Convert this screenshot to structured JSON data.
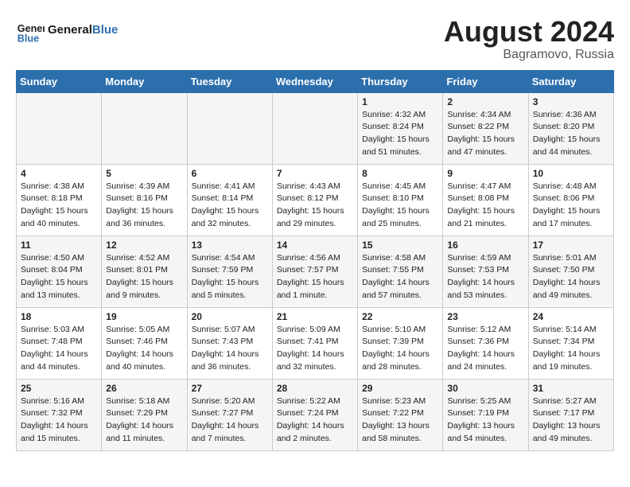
{
  "header": {
    "logo_text_part1": "General",
    "logo_text_part2": "Blue",
    "month_year": "August 2024",
    "location": "Bagramovo, Russia"
  },
  "weekdays": [
    "Sunday",
    "Monday",
    "Tuesday",
    "Wednesday",
    "Thursday",
    "Friday",
    "Saturday"
  ],
  "weeks": [
    [
      {
        "day": "",
        "info": ""
      },
      {
        "day": "",
        "info": ""
      },
      {
        "day": "",
        "info": ""
      },
      {
        "day": "",
        "info": ""
      },
      {
        "day": "1",
        "info": "Sunrise: 4:32 AM\nSunset: 8:24 PM\nDaylight: 15 hours\nand 51 minutes."
      },
      {
        "day": "2",
        "info": "Sunrise: 4:34 AM\nSunset: 8:22 PM\nDaylight: 15 hours\nand 47 minutes."
      },
      {
        "day": "3",
        "info": "Sunrise: 4:36 AM\nSunset: 8:20 PM\nDaylight: 15 hours\nand 44 minutes."
      }
    ],
    [
      {
        "day": "4",
        "info": "Sunrise: 4:38 AM\nSunset: 8:18 PM\nDaylight: 15 hours\nand 40 minutes."
      },
      {
        "day": "5",
        "info": "Sunrise: 4:39 AM\nSunset: 8:16 PM\nDaylight: 15 hours\nand 36 minutes."
      },
      {
        "day": "6",
        "info": "Sunrise: 4:41 AM\nSunset: 8:14 PM\nDaylight: 15 hours\nand 32 minutes."
      },
      {
        "day": "7",
        "info": "Sunrise: 4:43 AM\nSunset: 8:12 PM\nDaylight: 15 hours\nand 29 minutes."
      },
      {
        "day": "8",
        "info": "Sunrise: 4:45 AM\nSunset: 8:10 PM\nDaylight: 15 hours\nand 25 minutes."
      },
      {
        "day": "9",
        "info": "Sunrise: 4:47 AM\nSunset: 8:08 PM\nDaylight: 15 hours\nand 21 minutes."
      },
      {
        "day": "10",
        "info": "Sunrise: 4:48 AM\nSunset: 8:06 PM\nDaylight: 15 hours\nand 17 minutes."
      }
    ],
    [
      {
        "day": "11",
        "info": "Sunrise: 4:50 AM\nSunset: 8:04 PM\nDaylight: 15 hours\nand 13 minutes."
      },
      {
        "day": "12",
        "info": "Sunrise: 4:52 AM\nSunset: 8:01 PM\nDaylight: 15 hours\nand 9 minutes."
      },
      {
        "day": "13",
        "info": "Sunrise: 4:54 AM\nSunset: 7:59 PM\nDaylight: 15 hours\nand 5 minutes."
      },
      {
        "day": "14",
        "info": "Sunrise: 4:56 AM\nSunset: 7:57 PM\nDaylight: 15 hours\nand 1 minute."
      },
      {
        "day": "15",
        "info": "Sunrise: 4:58 AM\nSunset: 7:55 PM\nDaylight: 14 hours\nand 57 minutes."
      },
      {
        "day": "16",
        "info": "Sunrise: 4:59 AM\nSunset: 7:53 PM\nDaylight: 14 hours\nand 53 minutes."
      },
      {
        "day": "17",
        "info": "Sunrise: 5:01 AM\nSunset: 7:50 PM\nDaylight: 14 hours\nand 49 minutes."
      }
    ],
    [
      {
        "day": "18",
        "info": "Sunrise: 5:03 AM\nSunset: 7:48 PM\nDaylight: 14 hours\nand 44 minutes."
      },
      {
        "day": "19",
        "info": "Sunrise: 5:05 AM\nSunset: 7:46 PM\nDaylight: 14 hours\nand 40 minutes."
      },
      {
        "day": "20",
        "info": "Sunrise: 5:07 AM\nSunset: 7:43 PM\nDaylight: 14 hours\nand 36 minutes."
      },
      {
        "day": "21",
        "info": "Sunrise: 5:09 AM\nSunset: 7:41 PM\nDaylight: 14 hours\nand 32 minutes."
      },
      {
        "day": "22",
        "info": "Sunrise: 5:10 AM\nSunset: 7:39 PM\nDaylight: 14 hours\nand 28 minutes."
      },
      {
        "day": "23",
        "info": "Sunrise: 5:12 AM\nSunset: 7:36 PM\nDaylight: 14 hours\nand 24 minutes."
      },
      {
        "day": "24",
        "info": "Sunrise: 5:14 AM\nSunset: 7:34 PM\nDaylight: 14 hours\nand 19 minutes."
      }
    ],
    [
      {
        "day": "25",
        "info": "Sunrise: 5:16 AM\nSunset: 7:32 PM\nDaylight: 14 hours\nand 15 minutes."
      },
      {
        "day": "26",
        "info": "Sunrise: 5:18 AM\nSunset: 7:29 PM\nDaylight: 14 hours\nand 11 minutes."
      },
      {
        "day": "27",
        "info": "Sunrise: 5:20 AM\nSunset: 7:27 PM\nDaylight: 14 hours\nand 7 minutes."
      },
      {
        "day": "28",
        "info": "Sunrise: 5:22 AM\nSunset: 7:24 PM\nDaylight: 14 hours\nand 2 minutes."
      },
      {
        "day": "29",
        "info": "Sunrise: 5:23 AM\nSunset: 7:22 PM\nDaylight: 13 hours\nand 58 minutes."
      },
      {
        "day": "30",
        "info": "Sunrise: 5:25 AM\nSunset: 7:19 PM\nDaylight: 13 hours\nand 54 minutes."
      },
      {
        "day": "31",
        "info": "Sunrise: 5:27 AM\nSunset: 7:17 PM\nDaylight: 13 hours\nand 49 minutes."
      }
    ]
  ]
}
